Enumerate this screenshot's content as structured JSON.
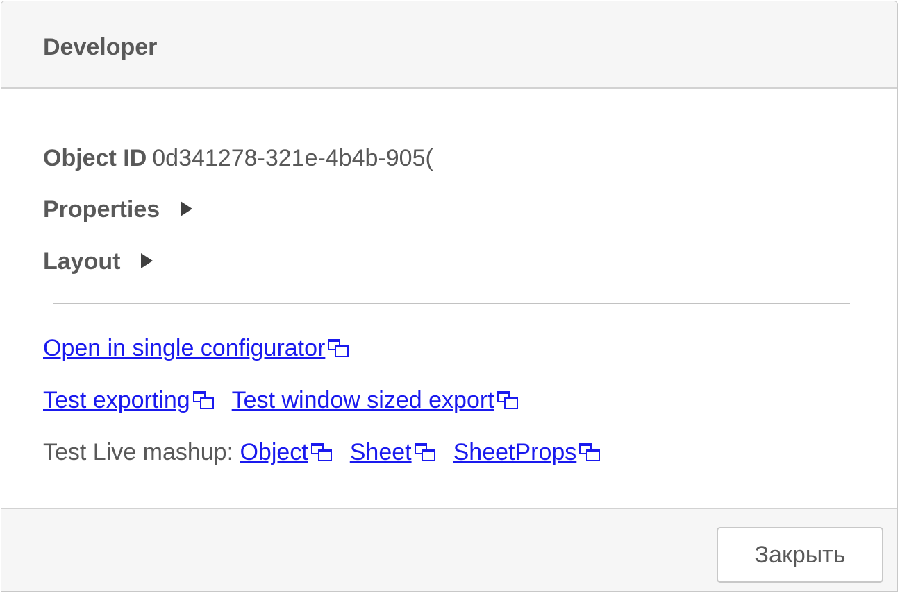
{
  "dialog": {
    "title": "Developer"
  },
  "object_id": {
    "label": "Object ID",
    "value": "0d341278-321e-4b4b-905("
  },
  "sections": {
    "properties_label": "Properties",
    "layout_label": "Layout"
  },
  "links": {
    "single_configurator": "Open in single configurator",
    "test_exporting": "Test exporting",
    "test_window_export": "Test window sized export"
  },
  "mashup": {
    "label": "Test Live mashup:",
    "object": "Object",
    "sheet": "Sheet",
    "sheet_props": "SheetProps"
  },
  "footer": {
    "close_label": "Закрыть"
  },
  "icons": {
    "expand": "triangle-right-icon",
    "external": "open-in-new-window-icon"
  },
  "colors": {
    "link": "#1a1aee",
    "text": "#595959",
    "header_bg": "#f6f6f6"
  }
}
